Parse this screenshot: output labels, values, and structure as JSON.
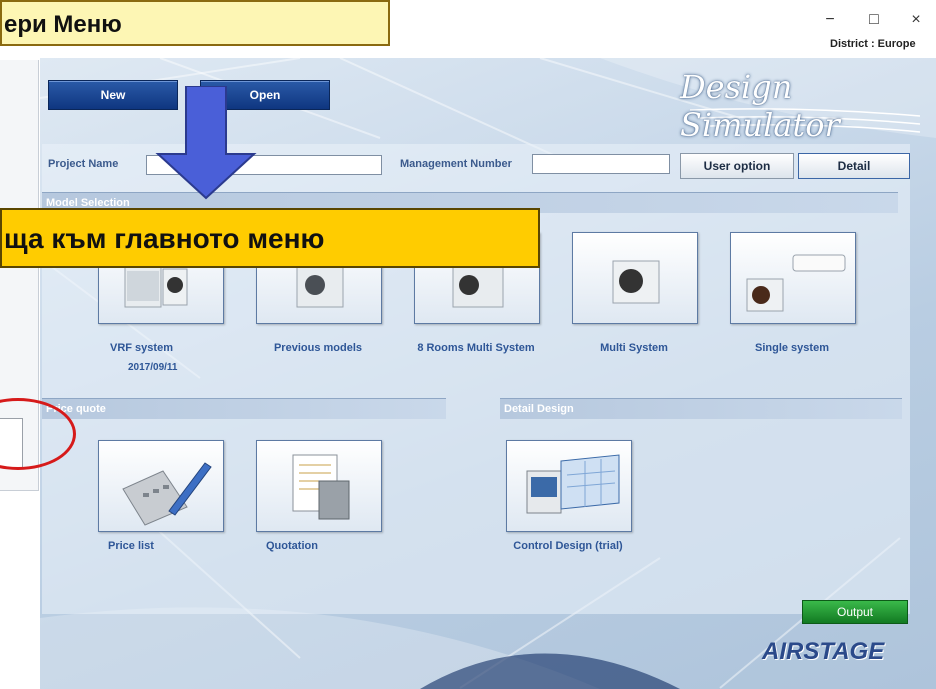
{
  "window": {
    "minimize_symbol": "−",
    "maximize_symbol": "□",
    "close_symbol": "×",
    "district": "District : Europe"
  },
  "logo": "Design Simulator",
  "toolbar": {
    "new_label": "New",
    "open_label": "Open"
  },
  "form": {
    "project_name_label": "Project Name",
    "project_name_value": "",
    "management_number_label": "Management Number",
    "management_number_value": "",
    "user_option_label": "User option",
    "detail_label": "Detail"
  },
  "model_selection": {
    "section_label": "Model Selection",
    "tiles": [
      {
        "label": "VRF system",
        "date": "2017/09/11",
        "icon": "vrf-outdoor-unit"
      },
      {
        "label": "Previous models",
        "icon": "outdoor-unit"
      },
      {
        "label": "8 Rooms Multi System",
        "icon": "multi-outdoor-unit"
      },
      {
        "label": "Multi System",
        "icon": "outdoor-unit"
      },
      {
        "label": "Single system",
        "icon": "split-ac"
      }
    ]
  },
  "price_quote": {
    "section_label": "Price quote",
    "tiles": [
      {
        "label": "Price list",
        "icon": "calculator-pen"
      },
      {
        "label": "Quotation",
        "icon": "document-calculator"
      }
    ]
  },
  "detail_design": {
    "section_label": "Detail Design",
    "tiles": [
      {
        "label": "Control Design (trial)",
        "icon": "controller-screen"
      }
    ]
  },
  "output_label": "Output",
  "brand": "AIRSTAGE",
  "overlays": {
    "callout_top": "ери Меню",
    "callout_mid": "ща към главното меню",
    "arrow_color": "#4a5fd8",
    "highlight_color": "#d61a1a"
  }
}
